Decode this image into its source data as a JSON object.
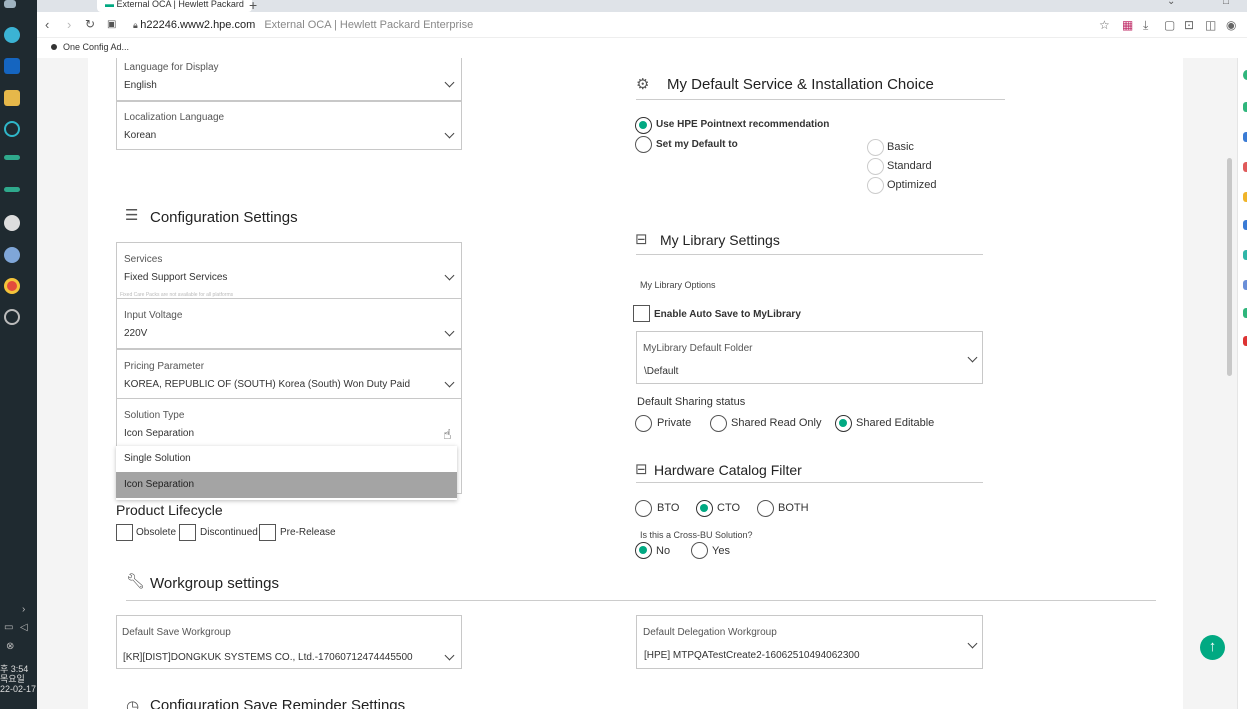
{
  "taskbar": {
    "clock_time": "후 3:54",
    "clock_day": "목요일",
    "clock_date": "22-02-17",
    "icons": [
      "edge-icon",
      "outlook-icon",
      "explorer-icon",
      "app-icon",
      "terminal-icon",
      "terminal2-icon",
      "help-icon",
      "cloud-icon",
      "chrome-icon",
      "settings-icon"
    ]
  },
  "browser": {
    "tab_title": "External OCA | Hewlett Packard",
    "tab_plus": "+",
    "url_domain": "h22246.www2.hpe.com",
    "url_title": "External OCA | Hewlett Packard Enterprise",
    "bookmark": "One Config Ad..."
  },
  "display": {
    "language_label": "Language for Display",
    "language_value": "English",
    "localization_label": "Localization Language",
    "localization_value": "Korean"
  },
  "config": {
    "title": "Configuration Settings",
    "services_label": "Services",
    "services_value": "Fixed Support Services",
    "services_note": "Fixed Care Packs are not available for all platforms",
    "voltage_label": "Input Voltage",
    "voltage_value": "220V",
    "pricing_label": "Pricing Parameter",
    "pricing_value": "KOREA, REPUBLIC OF (SOUTH) Korea (South) Won Duty Paid",
    "solution_label": "Solution Type",
    "solution_value": "Icon Separation",
    "solution_options": [
      "Single Solution",
      "Icon Separation"
    ]
  },
  "lifecycle": {
    "title": "Product Lifecycle",
    "obsolete": "Obsolete",
    "discontinued": "Discontinued",
    "prerelease": "Pre-Release"
  },
  "workgroup": {
    "title": "Workgroup settings",
    "save_label": "Default Save Workgroup",
    "save_value": "[KR][DIST]DONGKUK SYSTEMS CO., Ltd.-17060712474445500",
    "delegation_label": "Default Delegation Workgroup",
    "delegation_value": "[HPE] MTPQATestCreate2-16062510494062300"
  },
  "reminder": {
    "title": "Configuration Save Reminder Settings"
  },
  "service_choice": {
    "title": "My Default Service & Installation Choice",
    "use_hpe": "Use HPE Pointnext recommendation",
    "set_default": "Set my Default to",
    "basic": "Basic",
    "standard": "Standard",
    "optimized": "Optimized"
  },
  "library": {
    "title": "My Library Settings",
    "options_label": "My Library Options",
    "autosave": "Enable Auto Save to MyLibrary",
    "folder_label": "MyLibrary Default Folder",
    "folder_value": "\\Default",
    "sharing_label": "Default Sharing status",
    "private": "Private",
    "shared_read": "Shared Read Only",
    "shared_edit": "Shared Editable"
  },
  "catalog": {
    "title": "Hardware Catalog Filter",
    "bto": "BTO",
    "cto": "CTO",
    "both": "BOTH",
    "cross_bu_label": "Is this a Cross-BU Solution?",
    "no": "No",
    "yes": "Yes"
  },
  "colors": {
    "accent": "#01a982",
    "taskbar": "#1f2a30"
  }
}
